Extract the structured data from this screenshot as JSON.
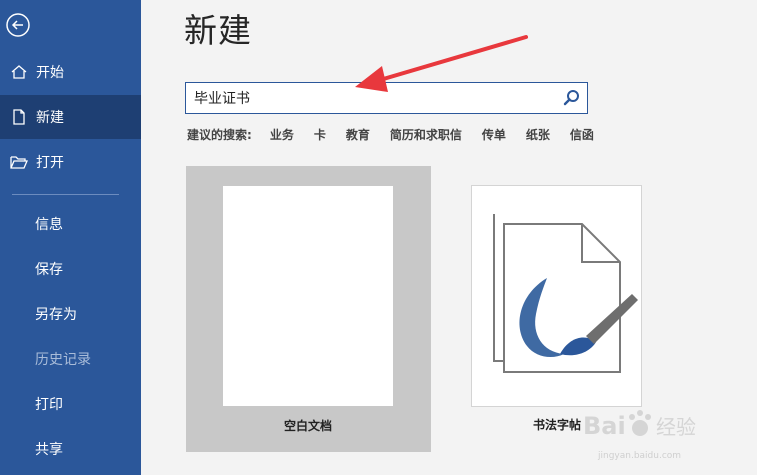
{
  "sidebar": {
    "back_icon": "back-arrow-icon",
    "items": [
      {
        "label": "开始",
        "icon": "home-icon"
      },
      {
        "label": "新建",
        "icon": "new-document-icon"
      },
      {
        "label": "打开",
        "icon": "open-folder-icon"
      },
      {
        "label": "信息"
      },
      {
        "label": "保存"
      },
      {
        "label": "另存为"
      },
      {
        "label": "历史记录"
      },
      {
        "label": "打印"
      },
      {
        "label": "共享"
      }
    ],
    "active_item": "新建"
  },
  "main": {
    "title": "新建",
    "search": {
      "value": "毕业证书",
      "icon": "search-icon"
    },
    "suggested": {
      "label": "建议的搜索:",
      "links": [
        "业务",
        "卡",
        "教育",
        "简历和求职信",
        "传单",
        "纸张",
        "信函"
      ]
    },
    "templates": [
      {
        "label": "空白文档",
        "selected": true
      },
      {
        "label": "书法字帖",
        "icon": "calligraphy-brush-icon"
      }
    ]
  },
  "watermark": {
    "brand": "Bai",
    "suffix": "经验",
    "url": "jingyan.baidu.com"
  },
  "colors": {
    "sidebar": "#2b579a",
    "sidebar_active": "#1e3f73",
    "annotation_arrow": "#e8383d"
  }
}
